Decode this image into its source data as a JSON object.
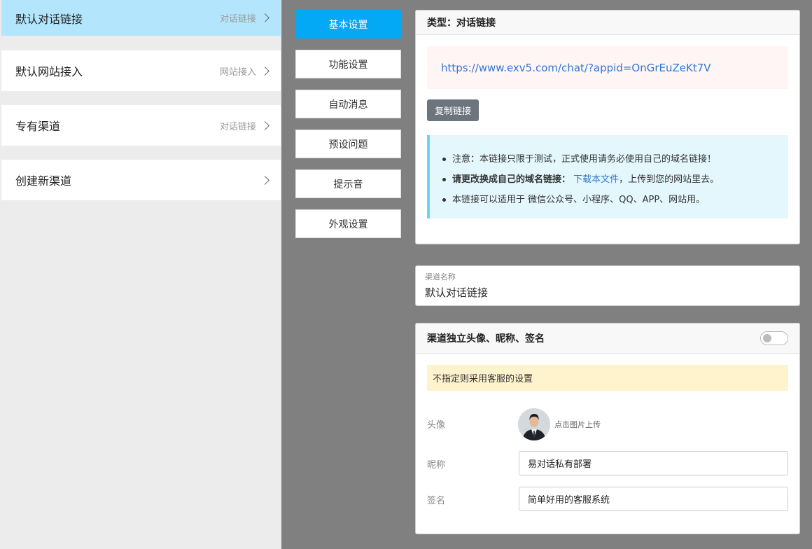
{
  "channels": [
    {
      "name": "默认对话链接",
      "type": "对话链接",
      "active": true
    },
    {
      "name": "默认网站接入",
      "type": "网站接入",
      "active": false
    },
    {
      "name": "专有渠道",
      "type": "对话链接",
      "active": false
    },
    {
      "name": "创建新渠道",
      "type": "",
      "active": false
    }
  ],
  "tabs": [
    {
      "label": "基本设置",
      "active": true
    },
    {
      "label": "功能设置",
      "active": false
    },
    {
      "label": "自动消息",
      "active": false
    },
    {
      "label": "预设问题",
      "active": false
    },
    {
      "label": "提示音",
      "active": false
    },
    {
      "label": "外观设置",
      "active": false
    }
  ],
  "link_card": {
    "header": "类型：对话链接",
    "url": "https://www.exv5.com/chat/?appid=OnGrEuZeKt7V",
    "copy_label": "复制链接",
    "notes": {
      "note1": "注意：本链接只限于测试，正式使用请务必使用自己的域名链接！",
      "note2_bold": "请更改换成自己的域名链接：",
      "note2_link": "下载本文件",
      "note2_tail": "，上传到您的网站里去。",
      "note3": "本链接可以适用于 微信公众号、小程序、QQ、APP、网站用。"
    }
  },
  "channel_name": {
    "label": "渠道名称",
    "value": "默认对话链接"
  },
  "profile_card": {
    "header": "渠道独立头像、昵称、签名",
    "toggle_on": false,
    "warning": "不指定则采用客服的设置",
    "avatar_label": "头像",
    "upload_hint": "点击图片上传",
    "nickname_label": "昵称",
    "nickname_value": "易对话私有部署",
    "signature_label": "签名",
    "signature_value": "简单好用的客服系统"
  },
  "colors": {
    "active_channel_bg": "#b3e5fc",
    "active_tab_bg": "#03a9f4",
    "link_color": "#2f77d1",
    "page_bg": "#808080"
  }
}
